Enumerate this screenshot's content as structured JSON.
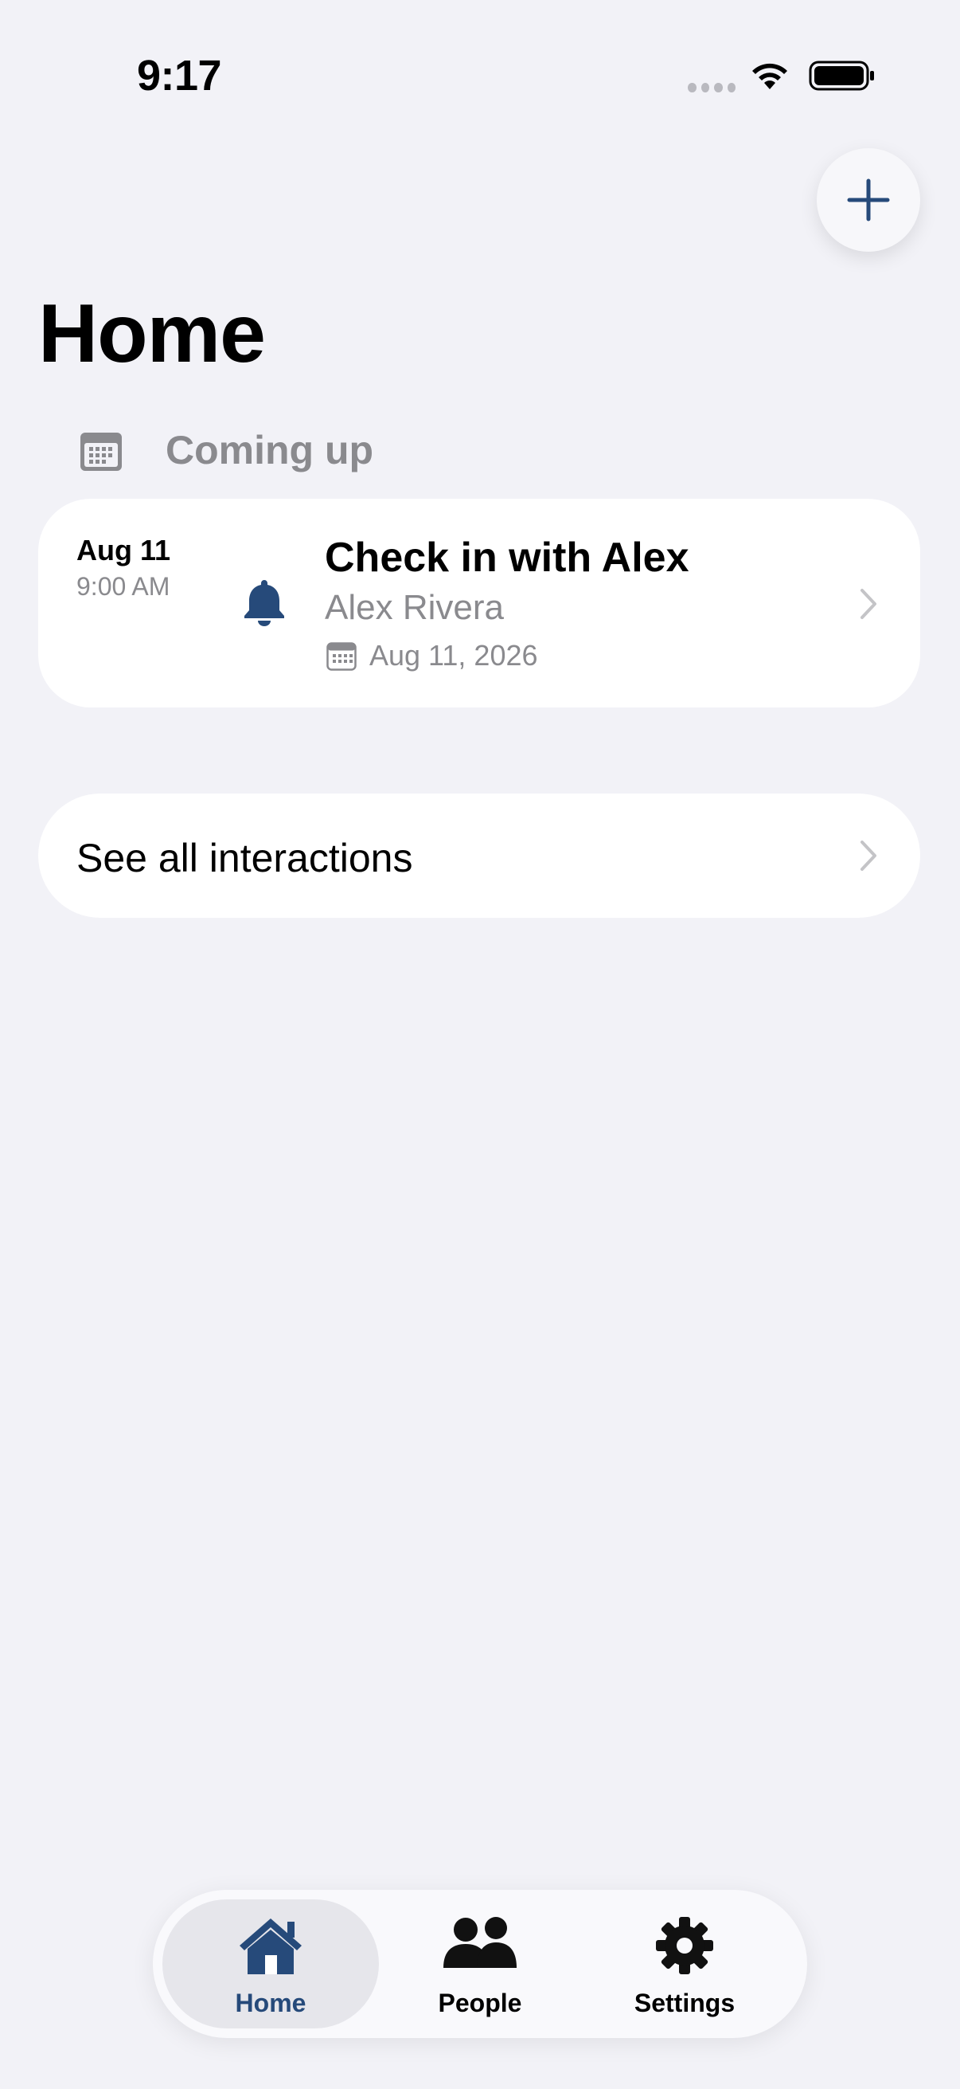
{
  "status_bar": {
    "time": "9:17"
  },
  "header": {
    "title": "Home"
  },
  "section": {
    "label": "Coming up"
  },
  "upcoming": {
    "date": "Aug 11",
    "time": "9:00 AM",
    "title": "Check in with Alex",
    "person": "Alex Rivera",
    "due_date": "Aug 11, 2026"
  },
  "see_all": {
    "label": "See all interactions"
  },
  "tabs": [
    {
      "label": "Home",
      "icon": "house-icon",
      "selected": true
    },
    {
      "label": "People",
      "icon": "people-icon",
      "selected": false
    },
    {
      "label": "Settings",
      "icon": "gear-icon",
      "selected": false
    }
  ],
  "colors": {
    "accent": "#264a7a",
    "background": "#f2f2f7",
    "secondary_text": "#8a8a8e"
  }
}
